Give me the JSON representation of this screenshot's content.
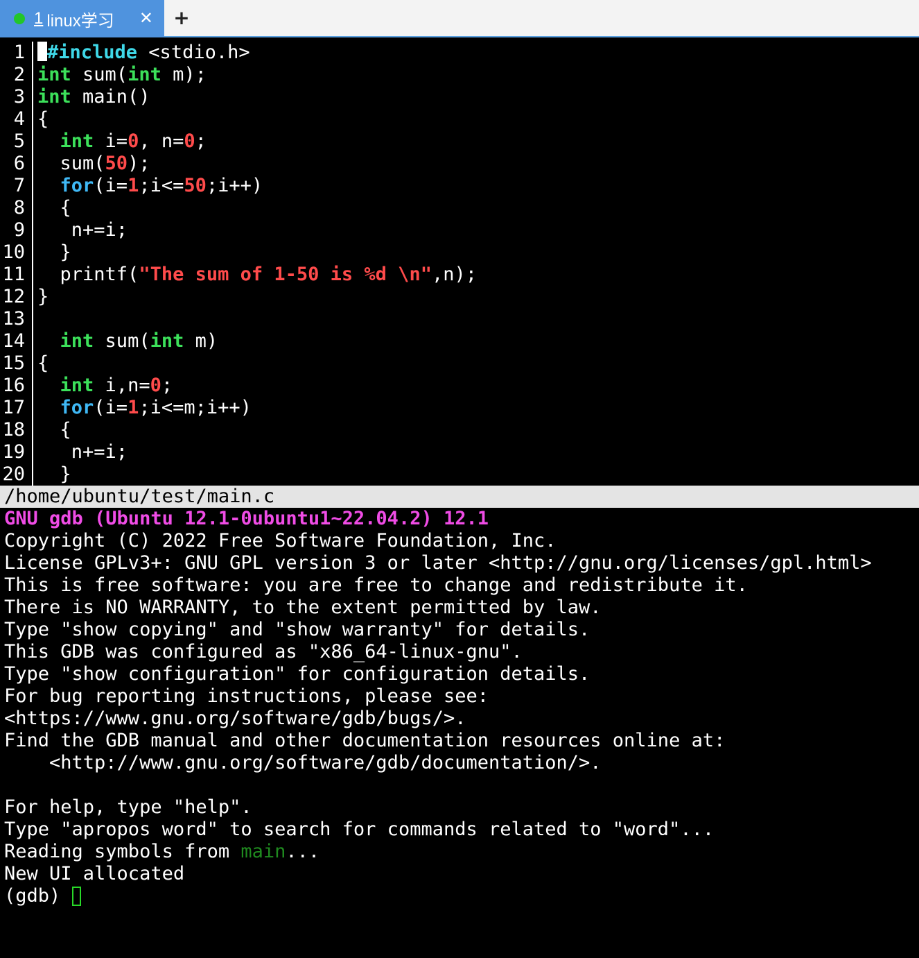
{
  "tab": {
    "number": "1",
    "title": "linux学习",
    "close_glyph": "✕",
    "status_dot_color": "#22c62a",
    "accent_color": "#4f93de"
  },
  "new_tab_glyph": "+",
  "source_pane": {
    "file_path": "/home/ubuntu/test/main.c",
    "lines": [
      {
        "n": "1",
        "tokens": [
          [
            "pp",
            "#include"
          ],
          [
            "pl",
            " <stdio.h>"
          ]
        ]
      },
      {
        "n": "2",
        "tokens": [
          [
            "kw",
            "int"
          ],
          [
            "pl",
            " sum("
          ],
          [
            "kw",
            "int"
          ],
          [
            "pl",
            " m);"
          ]
        ]
      },
      {
        "n": "3",
        "tokens": [
          [
            "kw",
            "int"
          ],
          [
            "pl",
            " main()"
          ]
        ]
      },
      {
        "n": "4",
        "tokens": [
          [
            "pl",
            "{"
          ]
        ]
      },
      {
        "n": "5",
        "tokens": [
          [
            "pl",
            "  "
          ],
          [
            "kw",
            "int"
          ],
          [
            "pl",
            " i="
          ],
          [
            "num",
            "0"
          ],
          [
            "pl",
            ", n="
          ],
          [
            "num",
            "0"
          ],
          [
            "pl",
            ";"
          ]
        ]
      },
      {
        "n": "6",
        "tokens": [
          [
            "pl",
            "  sum("
          ],
          [
            "num",
            "50"
          ],
          [
            "pl",
            ");"
          ]
        ]
      },
      {
        "n": "7",
        "tokens": [
          [
            "pl",
            "  "
          ],
          [
            "fl",
            "for"
          ],
          [
            "pl",
            "(i="
          ],
          [
            "num",
            "1"
          ],
          [
            "pl",
            ";i<="
          ],
          [
            "num",
            "50"
          ],
          [
            "pl",
            ";i++)"
          ]
        ]
      },
      {
        "n": "8",
        "tokens": [
          [
            "pl",
            "  {"
          ]
        ]
      },
      {
        "n": "9",
        "tokens": [
          [
            "pl",
            "   n+=i;"
          ]
        ]
      },
      {
        "n": "10",
        "tokens": [
          [
            "pl",
            "  }"
          ]
        ]
      },
      {
        "n": "11",
        "tokens": [
          [
            "pl",
            "  printf("
          ],
          [
            "str",
            "\"The sum of 1-50 is %d \\n\""
          ],
          [
            "pl",
            ",n);"
          ]
        ]
      },
      {
        "n": "12",
        "tokens": [
          [
            "pl",
            "}"
          ]
        ]
      },
      {
        "n": "13",
        "tokens": []
      },
      {
        "n": "14",
        "tokens": [
          [
            "pl",
            "  "
          ],
          [
            "kw",
            "int"
          ],
          [
            "pl",
            " sum("
          ],
          [
            "kw",
            "int"
          ],
          [
            "pl",
            " m)"
          ]
        ]
      },
      {
        "n": "15",
        "tokens": [
          [
            "pl",
            "{"
          ]
        ]
      },
      {
        "n": "16",
        "tokens": [
          [
            "pl",
            "  "
          ],
          [
            "kw",
            "int"
          ],
          [
            "pl",
            " i,n="
          ],
          [
            "num",
            "0"
          ],
          [
            "pl",
            ";"
          ]
        ]
      },
      {
        "n": "17",
        "tokens": [
          [
            "pl",
            "  "
          ],
          [
            "fl",
            "for"
          ],
          [
            "pl",
            "(i="
          ],
          [
            "num",
            "1"
          ],
          [
            "pl",
            ";i<=m;i++)"
          ]
        ]
      },
      {
        "n": "18",
        "tokens": [
          [
            "pl",
            "  {"
          ]
        ]
      },
      {
        "n": "19",
        "tokens": [
          [
            "pl",
            "   n+=i;"
          ]
        ]
      },
      {
        "n": "20",
        "tokens": [
          [
            "pl",
            "  }"
          ]
        ]
      }
    ]
  },
  "console": {
    "lines": [
      [
        [
          "gdb-header",
          "GNU gdb (Ubuntu 12.1-0ubuntu1~22.04.2) 12.1"
        ]
      ],
      [
        [
          "pl",
          "Copyright (C) 2022 Free Software Foundation, Inc."
        ]
      ],
      [
        [
          "pl",
          "License GPLv3+: GNU GPL version 3 or later <http://gnu.org/licenses/gpl.html>"
        ]
      ],
      [
        [
          "pl",
          "This is free software: you are free to change and redistribute it."
        ]
      ],
      [
        [
          "pl",
          "There is NO WARRANTY, to the extent permitted by law."
        ]
      ],
      [
        [
          "pl",
          "Type \"show copying\" and \"show warranty\" for details."
        ]
      ],
      [
        [
          "pl",
          "This GDB was configured as \"x86_64-linux-gnu\"."
        ]
      ],
      [
        [
          "pl",
          "Type \"show configuration\" for configuration details."
        ]
      ],
      [
        [
          "pl",
          "For bug reporting instructions, please see:"
        ]
      ],
      [
        [
          "pl",
          "<https://www.gnu.org/software/gdb/bugs/>."
        ]
      ],
      [
        [
          "pl",
          "Find the GDB manual and other documentation resources online at:"
        ]
      ],
      [
        [
          "pl",
          "    <http://www.gnu.org/software/gdb/documentation/>."
        ]
      ],
      [],
      [
        [
          "pl",
          "For help, type \"help\"."
        ]
      ],
      [
        [
          "pl",
          "Type \"apropos word\" to search for commands related to \"word\"..."
        ]
      ],
      [
        [
          "pl",
          "Reading symbols from "
        ],
        [
          "green-text",
          "main"
        ],
        [
          "pl",
          "..."
        ]
      ],
      [
        [
          "pl",
          "New UI allocated"
        ]
      ]
    ],
    "prompt": "(gdb) "
  }
}
